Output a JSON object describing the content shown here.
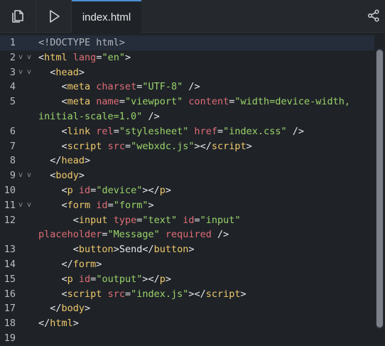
{
  "toolbar": {
    "files_icon": "copy-files-icon",
    "run_icon": "play-icon",
    "share_icon": "share-icon",
    "active_tab": "index.html"
  },
  "editor": {
    "lines": [
      {
        "n": "1",
        "fold": "",
        "parts": [
          [
            "d",
            "<!DOCTYPE html>"
          ]
        ]
      },
      {
        "n": "2",
        "fold": "v v",
        "parts": [
          [
            "t",
            "<"
          ],
          [
            "k",
            "html"
          ],
          [
            "t",
            " "
          ],
          [
            "a",
            "lang"
          ],
          [
            "t",
            "="
          ],
          [
            "s",
            "\"en\""
          ],
          [
            "t",
            ">"
          ]
        ]
      },
      {
        "n": "3",
        "fold": "v v",
        "parts": [
          [
            "t",
            "  <"
          ],
          [
            "k",
            "head"
          ],
          [
            "t",
            ">"
          ]
        ]
      },
      {
        "n": "4",
        "fold": "",
        "parts": [
          [
            "t",
            "    <"
          ],
          [
            "k",
            "meta"
          ],
          [
            "t",
            " "
          ],
          [
            "a",
            "charset"
          ],
          [
            "t",
            "="
          ],
          [
            "s",
            "\"UTF-8\""
          ],
          [
            "t",
            " />"
          ]
        ]
      },
      {
        "n": "5",
        "fold": "",
        "parts": [
          [
            "t",
            "    <"
          ],
          [
            "k",
            "meta"
          ],
          [
            "t",
            " "
          ],
          [
            "a",
            "name"
          ],
          [
            "t",
            "="
          ],
          [
            "s",
            "\"viewport\""
          ],
          [
            "t",
            " "
          ],
          [
            "a",
            "content"
          ],
          [
            "t",
            "="
          ],
          [
            "s",
            "\"width=device-width,"
          ]
        ]
      },
      {
        "n": "",
        "fold": "",
        "parts": [
          [
            "s",
            "initial-scale=1.0\""
          ],
          [
            "t",
            " />"
          ]
        ]
      },
      {
        "n": "6",
        "fold": "",
        "parts": [
          [
            "t",
            "    <"
          ],
          [
            "k",
            "link"
          ],
          [
            "t",
            " "
          ],
          [
            "a",
            "rel"
          ],
          [
            "t",
            "="
          ],
          [
            "s",
            "\"stylesheet\""
          ],
          [
            "t",
            " "
          ],
          [
            "a",
            "href"
          ],
          [
            "t",
            "="
          ],
          [
            "s",
            "\"index.css\""
          ],
          [
            "t",
            " />"
          ]
        ]
      },
      {
        "n": "7",
        "fold": "",
        "parts": [
          [
            "t",
            "    <"
          ],
          [
            "k",
            "script"
          ],
          [
            "t",
            " "
          ],
          [
            "a",
            "src"
          ],
          [
            "t",
            "="
          ],
          [
            "s",
            "\"webxdc.js\""
          ],
          [
            "t",
            "></"
          ],
          [
            "k",
            "script"
          ],
          [
            "t",
            ">"
          ]
        ]
      },
      {
        "n": "8",
        "fold": "",
        "parts": [
          [
            "t",
            "  </"
          ],
          [
            "k",
            "head"
          ],
          [
            "t",
            ">"
          ]
        ]
      },
      {
        "n": "9",
        "fold": "v v",
        "parts": [
          [
            "t",
            "  <"
          ],
          [
            "k",
            "body"
          ],
          [
            "t",
            ">"
          ]
        ]
      },
      {
        "n": "10",
        "fold": "",
        "parts": [
          [
            "t",
            "    <"
          ],
          [
            "k",
            "p"
          ],
          [
            "t",
            " "
          ],
          [
            "a",
            "id"
          ],
          [
            "t",
            "="
          ],
          [
            "s",
            "\"device\""
          ],
          [
            "t",
            "></"
          ],
          [
            "k",
            "p"
          ],
          [
            "t",
            ">"
          ]
        ]
      },
      {
        "n": "11",
        "fold": "v v",
        "parts": [
          [
            "t",
            "    <"
          ],
          [
            "k",
            "form"
          ],
          [
            "t",
            " "
          ],
          [
            "a",
            "id"
          ],
          [
            "t",
            "="
          ],
          [
            "s",
            "\"form\""
          ],
          [
            "t",
            ">"
          ]
        ]
      },
      {
        "n": "12",
        "fold": "",
        "parts": [
          [
            "t",
            "      <"
          ],
          [
            "k",
            "input"
          ],
          [
            "t",
            " "
          ],
          [
            "a",
            "type"
          ],
          [
            "t",
            "="
          ],
          [
            "s",
            "\"text\""
          ],
          [
            "t",
            " "
          ],
          [
            "a",
            "id"
          ],
          [
            "t",
            "="
          ],
          [
            "s",
            "\"input\""
          ]
        ]
      },
      {
        "n": "",
        "fold": "",
        "parts": [
          [
            "a",
            "placeholder"
          ],
          [
            "t",
            "="
          ],
          [
            "s",
            "\"Message\""
          ],
          [
            "t",
            " "
          ],
          [
            "a",
            "required"
          ],
          [
            "t",
            " />"
          ]
        ]
      },
      {
        "n": "13",
        "fold": "",
        "parts": [
          [
            "t",
            "      <"
          ],
          [
            "k",
            "button"
          ],
          [
            "t",
            ">Send</"
          ],
          [
            "k",
            "button"
          ],
          [
            "t",
            ">"
          ]
        ]
      },
      {
        "n": "14",
        "fold": "",
        "parts": [
          [
            "t",
            "    </"
          ],
          [
            "k",
            "form"
          ],
          [
            "t",
            ">"
          ]
        ]
      },
      {
        "n": "15",
        "fold": "",
        "parts": [
          [
            "t",
            "    <"
          ],
          [
            "k",
            "p"
          ],
          [
            "t",
            " "
          ],
          [
            "a",
            "id"
          ],
          [
            "t",
            "="
          ],
          [
            "s",
            "\"output\""
          ],
          [
            "t",
            "></"
          ],
          [
            "k",
            "p"
          ],
          [
            "t",
            ">"
          ]
        ]
      },
      {
        "n": "16",
        "fold": "",
        "parts": [
          [
            "t",
            "    <"
          ],
          [
            "k",
            "script"
          ],
          [
            "t",
            " "
          ],
          [
            "a",
            "src"
          ],
          [
            "t",
            "="
          ],
          [
            "s",
            "\"index.js\""
          ],
          [
            "t",
            "></"
          ],
          [
            "k",
            "script"
          ],
          [
            "t",
            ">"
          ]
        ]
      },
      {
        "n": "17",
        "fold": "",
        "parts": [
          [
            "t",
            "  </"
          ],
          [
            "k",
            "body"
          ],
          [
            "t",
            ">"
          ]
        ]
      },
      {
        "n": "18",
        "fold": "",
        "parts": [
          [
            "t",
            "</"
          ],
          [
            "k",
            "html"
          ],
          [
            "t",
            ">"
          ]
        ]
      },
      {
        "n": "19",
        "fold": "",
        "parts": []
      }
    ]
  },
  "colors": {
    "background": "#1f2328",
    "tag": "#f0c96b",
    "attribute": "#e06c75",
    "string": "#9bd36a",
    "active_tab_border": "#4d8fd6"
  }
}
